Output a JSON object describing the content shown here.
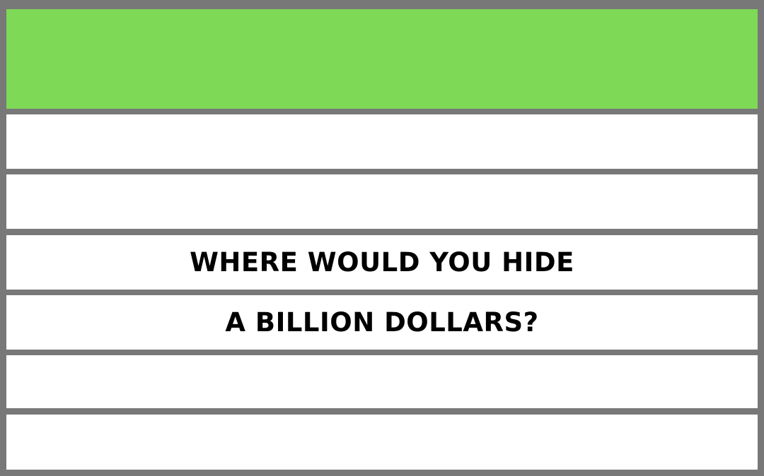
{
  "colors": {
    "header": "#7ed957",
    "row": "#ffffff",
    "border": "#787878",
    "text": "#000000"
  },
  "rows": [
    {
      "text": ""
    },
    {
      "text": ""
    },
    {
      "text": "WHERE WOULD YOU HIDE"
    },
    {
      "text": "A BILLION DOLLARS?"
    },
    {
      "text": ""
    },
    {
      "text": ""
    }
  ]
}
